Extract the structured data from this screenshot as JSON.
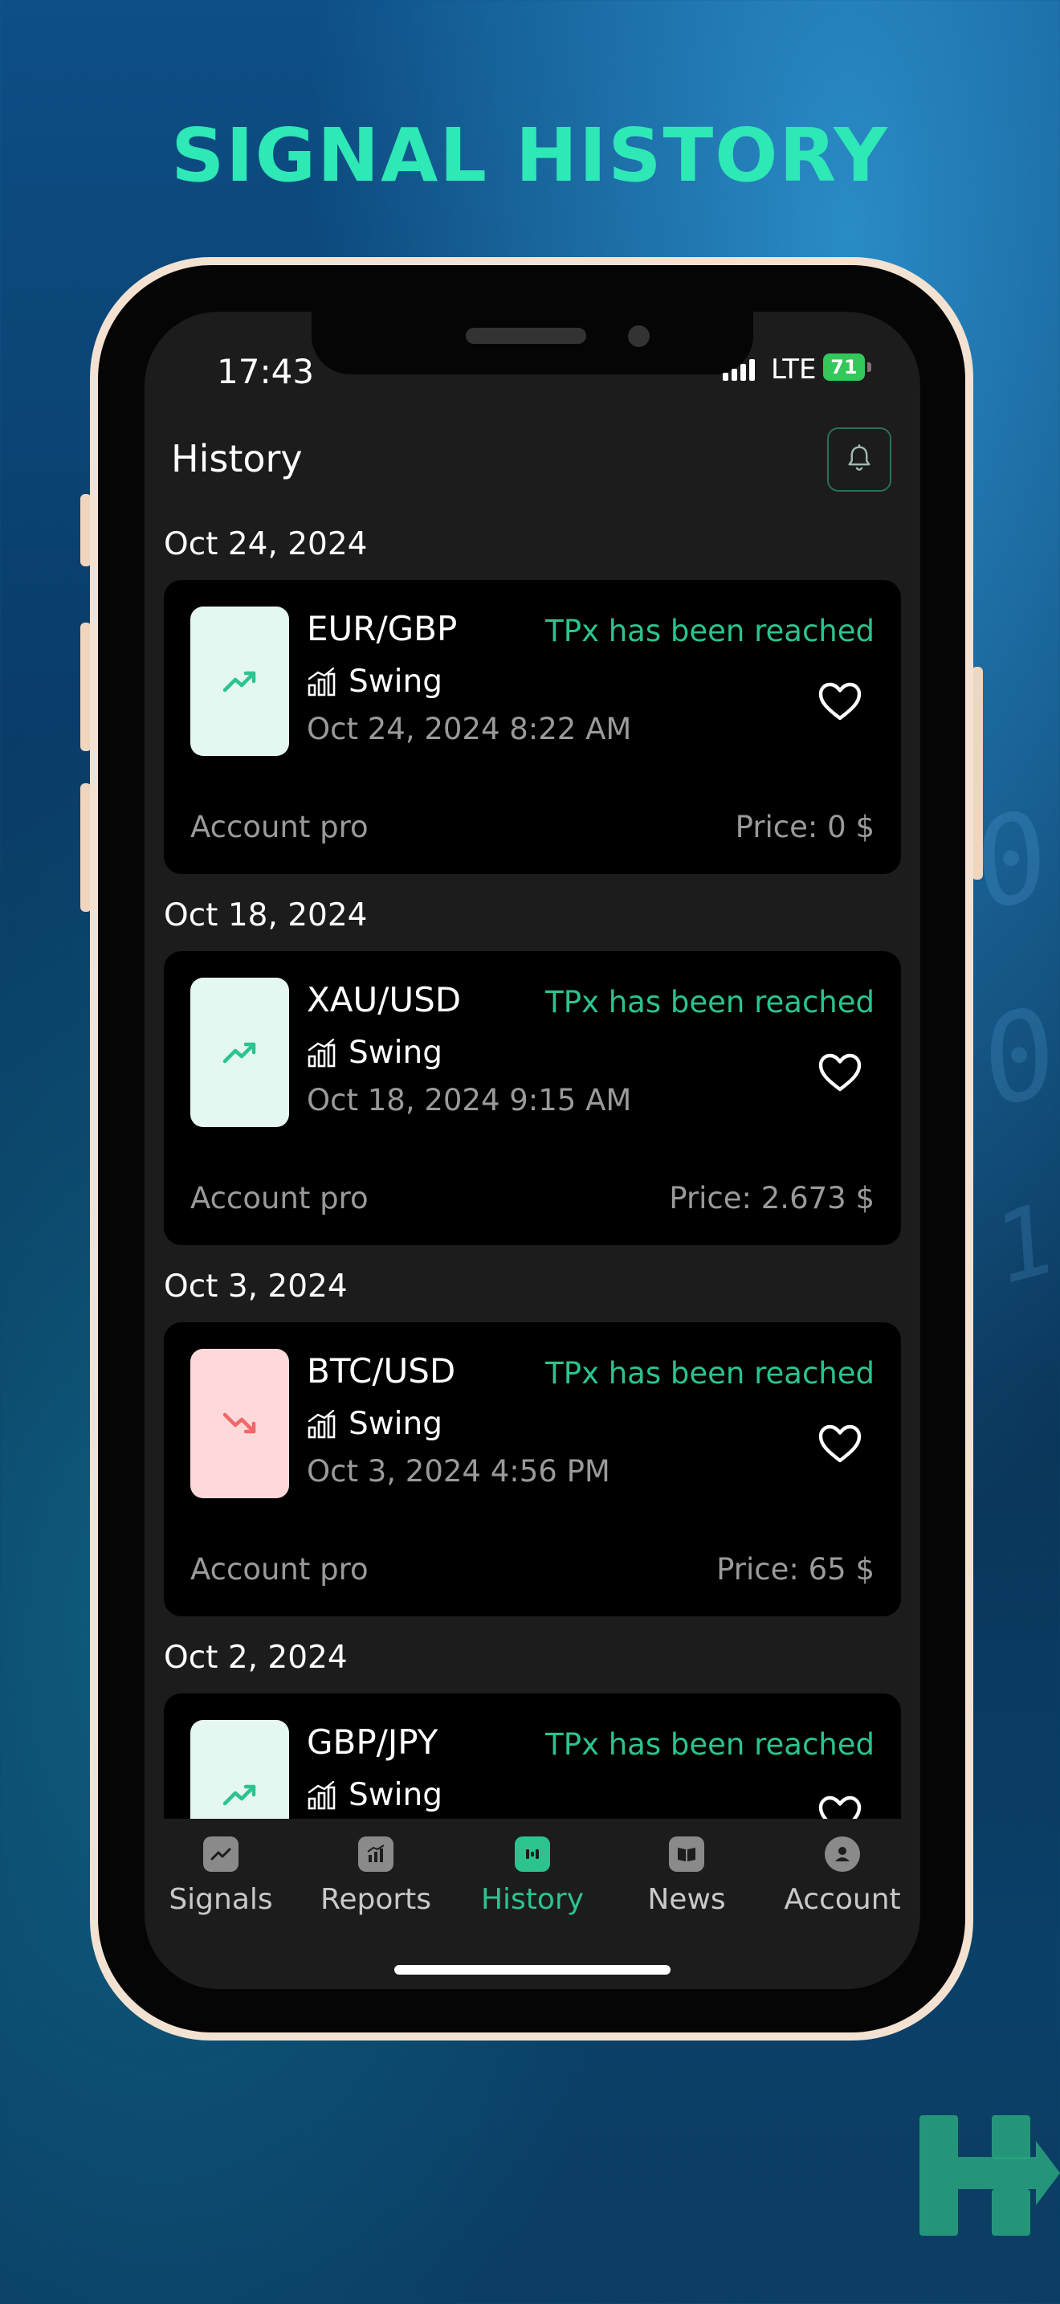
{
  "poster": {
    "title": "SIGNAL HISTORY",
    "brand_color": "#2ee8b6",
    "background_digits": [
      "0",
      "0",
      "1"
    ]
  },
  "status_bar": {
    "time": "17:43",
    "network": "LTE",
    "battery": "71"
  },
  "header": {
    "title": "History",
    "bell_icon": "bell-icon"
  },
  "history": [
    {
      "date": "Oct 24, 2024",
      "pair": "EUR/GBP",
      "status": "TPx has been reached",
      "type": "Swing",
      "datetime": "Oct 24, 2024 8:22 AM",
      "account": "Account pro",
      "price": "Price: 0 $",
      "direction": "up"
    },
    {
      "date": "Oct 18, 2024",
      "pair": "XAU/USD",
      "status": "TPx has been reached",
      "type": "Swing",
      "datetime": "Oct 18, 2024 9:15 AM",
      "account": "Account pro",
      "price": "Price: 2.673 $",
      "direction": "up"
    },
    {
      "date": "Oct 3, 2024",
      "pair": "BTC/USD",
      "status": "TPx has been reached",
      "type": "Swing",
      "datetime": "Oct 3, 2024 4:56 PM",
      "account": "Account pro",
      "price": "Price: 65 $",
      "direction": "down"
    },
    {
      "date": "Oct 2, 2024",
      "pair": "GBP/JPY",
      "status": "TPx has been reached",
      "type": "Swing",
      "direction": "up"
    }
  ],
  "tabs": [
    {
      "label": "Signals",
      "icon": "signals-icon",
      "active": false
    },
    {
      "label": "Reports",
      "icon": "reports-icon",
      "active": false
    },
    {
      "label": "History",
      "icon": "history-icon",
      "active": true
    },
    {
      "label": "News",
      "icon": "news-icon",
      "active": false
    },
    {
      "label": "Account",
      "icon": "account-icon",
      "active": false
    }
  ],
  "colors": {
    "accent": "#2cc38f",
    "up_bg": "#e4f8f1",
    "down_bg": "#ffd9da",
    "down_icon": "#f0686a"
  }
}
